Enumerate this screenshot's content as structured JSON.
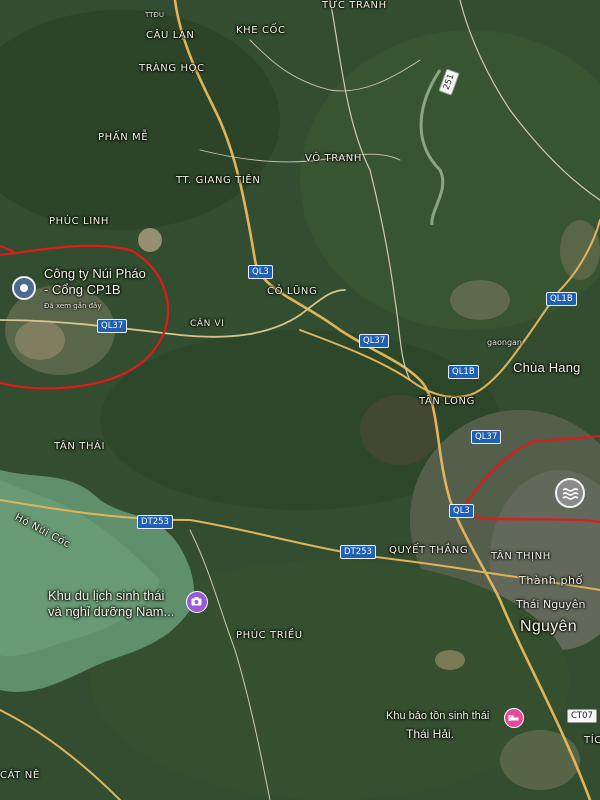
{
  "places": {
    "tuc_tranh": "TỨC TRANH",
    "ttdu": "TTĐU",
    "cau_lan": "CÂU LẠN",
    "khe_coc": "KHE CỐC",
    "trang_hoc": "TRÀNG HỌC",
    "phan_me": "PHẤN MỄ",
    "vo_tranh": "VÔ TRANH",
    "giang_tien": "TT. GIANG TIÊN",
    "phuc_linh": "PHÚC LINH",
    "co_lung": "CỎ LŨNG",
    "can_vi": "CÂN VI",
    "gaongan": "gaongan",
    "chua_hang": "Chùa Hang",
    "tan_long": "TÂN LONG",
    "tan_thai": "TÂN THÁI",
    "ho_nui_coc": "Hồ Núi Cốc",
    "quyet_thang": "QUYẾT THẮNG",
    "tan_thinh": "TÂN THỊNH",
    "thanh_pho": "Thành phố",
    "thai_nguyen_small": "Thái Nguyên",
    "nguyen": "Nguyên",
    "phuc_triu": "PHÚC TRIỀU",
    "cat_ne": "CÁT NÊ",
    "tic": "TÍC"
  },
  "roads": {
    "ql3_a": "QL3",
    "ql37_a": "QL37",
    "ql37_b": "QL37",
    "ql37_c": "QL37",
    "ql1b_a": "QL1B",
    "ql1b_b": "QL1B",
    "ql3_b": "QL3",
    "dt253_a": "DT253",
    "dt253_b": "DT253",
    "ct07": "CT07",
    "road_251": "251"
  },
  "pois": {
    "nui_phao_line1": "Công ty Núi Pháo",
    "nui_phao_line2": "- Cổng CP1B",
    "nui_phao_sub": "Đã xem gần đây",
    "resort_line1": "Khu du lịch sinh thái",
    "resort_line2": "và nghỉ dưỡng Nam...",
    "reserve_line1": "Khu bảo tồn sinh thái",
    "reserve_line2": "Thái Hải."
  },
  "icons": {
    "nui_phao": "map-pin-icon",
    "resort": "camera-icon",
    "reserve": "hotel-icon",
    "city": "water-waves-icon"
  },
  "colors": {
    "annotation": "#e01b1b",
    "highway": "#e0b45a",
    "shield": "#1f5fb4",
    "poi_pink": "#e8489a",
    "poi_purple": "#9a5ad6"
  }
}
